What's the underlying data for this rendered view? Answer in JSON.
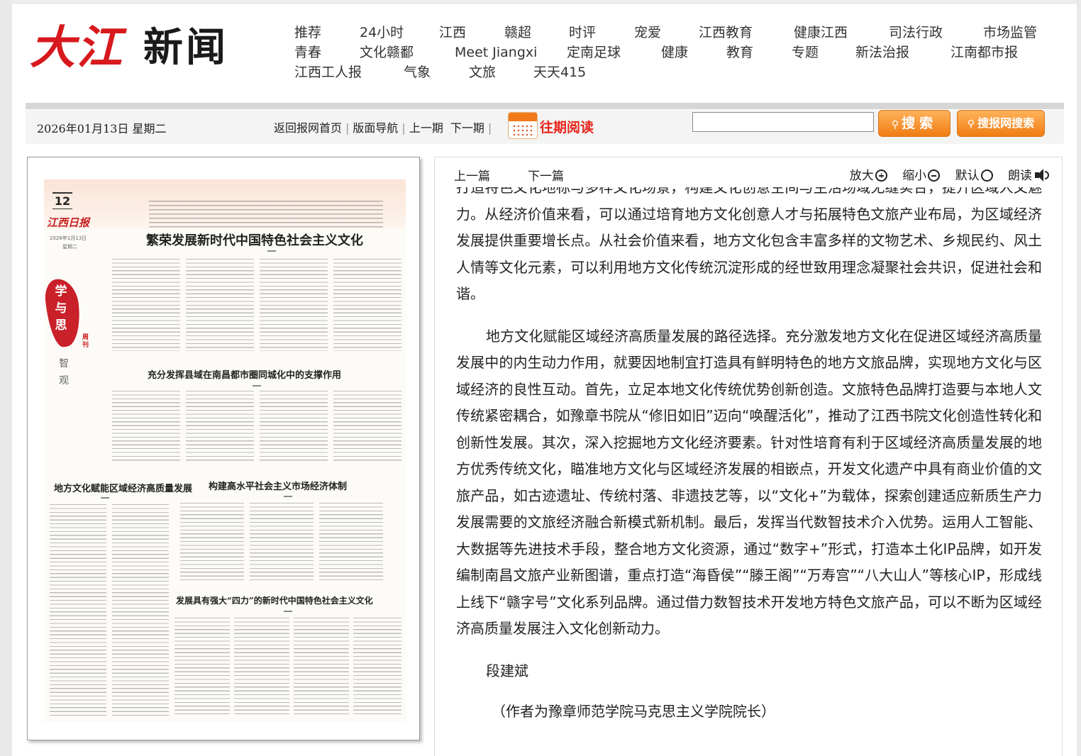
{
  "logo": {
    "red": "大江",
    "black": "新闻"
  },
  "topnav": {
    "rows": [
      [
        "推荐",
        "24小时",
        "江西",
        "赣超",
        "时评",
        "宠爱",
        "江西教育",
        "健康江西",
        "司法行政",
        "市场监管"
      ],
      [
        "青春",
        "文化赣鄱",
        "Meet Jiangxi",
        "定南足球",
        "健康",
        "教育",
        "专题",
        "新法治报",
        "江南都市报"
      ],
      [
        "江西工人报",
        "气象",
        "文旅",
        "天天415"
      ]
    ]
  },
  "toolbar": {
    "date": "2026年01月13日 星期二",
    "links": [
      "返回报网首页",
      "版面导航",
      "上一期",
      "下一期"
    ],
    "past_reading": "往期阅读",
    "search_value": "",
    "search_button": "搜索",
    "site_search_button": "搜报网搜索"
  },
  "paper": {
    "page_number": "12",
    "brand": "江西日报",
    "date": "2026年1月13日",
    "weekday": "星期二",
    "seal_chars": "学与思",
    "volume": "周刊",
    "column": "智观",
    "headlines": [
      "繁荣发展新时代中国特色社会主义文化",
      "充分发挥县域在南昌都市圈同城化中的支撑作用",
      "地方文化赋能区域经济高质量发展",
      "构建高水平社会主义市场经济体制",
      "发展具有强大“四力”的新时代中国特色社会主义文化"
    ]
  },
  "article": {
    "prev": "上一篇",
    "next": "下一篇",
    "tools": {
      "zoom_in": "放大",
      "zoom_out": "缩小",
      "default": "默认",
      "read": "朗读"
    },
    "paragraphs": [
      "打造特色文化地标与多样文化场景，构建文化创意空间与生活场域无缝实合，提升区域人文魅力。从经济价值来看，可以通过培育地方文化创意人才与拓展特色文旅产业布局，为区域经济发展提供重要增长点。从社会价值来看，地方文化包含丰富多样的文物艺术、乡规民约、风土人情等文化元素，可以利用地方文化传统沉淀形成的经世致用理念凝聚社会共识，促进社会和谐。",
      "地方文化赋能区域经济高质量发展的路径选择。充分激发地方文化在促进区域经济高质量发展中的内生动力作用，就要因地制宜打造具有鲜明特色的地方文旅品牌，实现地方文化与区域经济的良性互动。首先，立足本地文化传统优势创新创造。文旅特色品牌打造要与本地人文传统紧密耦合，如豫章书院从“修旧如旧”迈向“唤醒活化”，推动了江西书院文化创造性转化和创新性发展。其次，深入挖掘地方文化经济要素。针对性培育有利于区域经济高质量发展的地方优秀传统文化，瞄准地方文化与区域经济发展的相嵌点，开发文化遗产中具有商业价值的文旅产品，如古迹遗址、传统村落、非遗技艺等，以“文化+”为载体，探索创建适应新质生产力发展需要的文旅经济融合新模式新机制。最后，发挥当代数智技术介入优势。运用人工智能、大数据等先进技术手段，整合地方文化资源，通过“数字+”形式，打造本土化IP品牌，如开发编制南昌文旅产业新图谱，重点打造“海昏侯”“滕王阁”“万寿宫”“八大山人”等核心IP，形成线上线下“赣字号”文化系列品牌。通过借力数智技术开发地方特色文旅产品，可以不断为区域经济高质量发展注入文化创新动力。"
    ],
    "author": "段建斌",
    "note": "（作者为豫章师范学院马克思主义学院院长）"
  },
  "colors": {
    "brand_red": "#d7191d",
    "accent_orange": "#f07c14",
    "past_red": "#e8251b"
  }
}
